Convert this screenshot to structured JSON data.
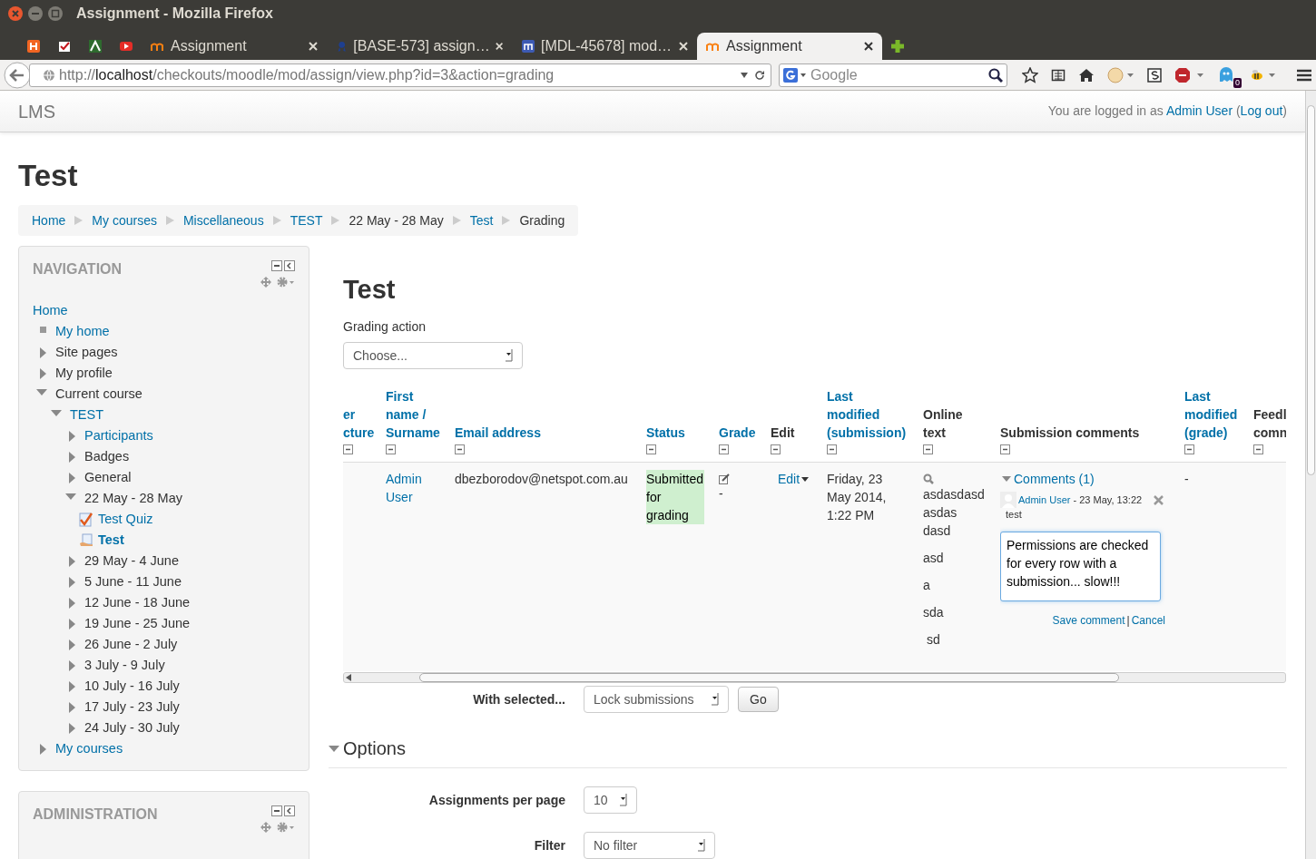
{
  "window": {
    "title": "Assignment - Mozilla Firefox"
  },
  "tabs": [
    {
      "kind": "pinned",
      "selected": false
    },
    {
      "kind": "pinned",
      "selected": false
    },
    {
      "kind": "pinned",
      "selected": false
    },
    {
      "kind": "pinned",
      "selected": false
    },
    {
      "kind": "full",
      "label": "Assignment",
      "selected": false
    },
    {
      "kind": "full",
      "label": "[BASE-573] assign…",
      "selected": false
    },
    {
      "kind": "full",
      "label": "[MDL-45678] mod…",
      "selected": false
    },
    {
      "kind": "full",
      "label": "Assignment",
      "selected": true
    }
  ],
  "address_bar": {
    "scheme": "http://",
    "host": "localhost",
    "path": "/checkouts/moodle/mod/assign/view.php?id=3&action=grading"
  },
  "search": {
    "placeholder": "Google"
  },
  "toolbar": {
    "badge": "0"
  },
  "site_header": {
    "brand": "LMS",
    "login_text": "You are logged in as",
    "user": "Admin User",
    "open_paren": "(",
    "logout": "Log out",
    "close_paren": ")"
  },
  "page_title": "Test",
  "breadcrumb": [
    {
      "label": "Home",
      "link": true
    },
    {
      "label": "My courses",
      "link": true
    },
    {
      "label": "Miscellaneous",
      "link": true
    },
    {
      "label": "TEST",
      "link": true
    },
    {
      "label": "22 May - 28 May",
      "link": false
    },
    {
      "label": "Test",
      "link": true
    },
    {
      "label": "Grading",
      "link": false
    }
  ],
  "navigation": {
    "title": "NAVIGATION",
    "items": [
      {
        "label": "Home",
        "kind": "plain",
        "link": true
      },
      {
        "label": "My home",
        "kind": "bullet",
        "link": true
      },
      {
        "label": "Site pages",
        "kind": "branch",
        "link": false,
        "expanded": false
      },
      {
        "label": "My profile",
        "kind": "branch",
        "link": false,
        "expanded": false
      },
      {
        "label": "Current course",
        "kind": "branch",
        "link": false,
        "expanded": true,
        "children": [
          {
            "label": "TEST",
            "kind": "branch",
            "link": true,
            "expanded": true,
            "children": [
              {
                "label": "Participants",
                "kind": "branch",
                "link": true,
                "expanded": false
              },
              {
                "label": "Badges",
                "kind": "branch",
                "link": false,
                "expanded": false
              },
              {
                "label": "General",
                "kind": "branch",
                "link": false,
                "expanded": false
              },
              {
                "label": "22 May - 28 May",
                "kind": "branch",
                "link": false,
                "expanded": true,
                "children": [
                  {
                    "label": "Test Quiz",
                    "kind": "quiz",
                    "link": true,
                    "current": false
                  },
                  {
                    "label": "Test",
                    "kind": "assign",
                    "link": true,
                    "current": true
                  }
                ]
              },
              {
                "label": "29 May - 4 June",
                "kind": "branch",
                "link": false,
                "expanded": false
              },
              {
                "label": "5 June - 11 June",
                "kind": "branch",
                "link": false,
                "expanded": false
              },
              {
                "label": "12 June - 18 June",
                "kind": "branch",
                "link": false,
                "expanded": false
              },
              {
                "label": "19 June - 25 June",
                "kind": "branch",
                "link": false,
                "expanded": false
              },
              {
                "label": "26 June - 2 July",
                "kind": "branch",
                "link": false,
                "expanded": false
              },
              {
                "label": "3 July - 9 July",
                "kind": "branch",
                "link": false,
                "expanded": false
              },
              {
                "label": "10 July - 16 July",
                "kind": "branch",
                "link": false,
                "expanded": false
              },
              {
                "label": "17 July - 23 July",
                "kind": "branch",
                "link": false,
                "expanded": false
              },
              {
                "label": "24 July - 30 July",
                "kind": "branch",
                "link": false,
                "expanded": false
              }
            ]
          }
        ]
      },
      {
        "label": "My courses",
        "kind": "branch",
        "link": true,
        "expanded": false
      }
    ]
  },
  "administration": {
    "title": "ADMINISTRATION"
  },
  "main": {
    "heading": "Test",
    "grading_action_label": "Grading action",
    "grading_action_value": "Choose..."
  },
  "table": {
    "columns": [
      {
        "lines": [
          "er",
          "cture"
        ],
        "link": true
      },
      {
        "lines": [
          "First",
          "name /",
          "Surname"
        ],
        "link": true
      },
      {
        "lines": [
          "Email address"
        ],
        "link": true
      },
      {
        "lines": [
          "Status"
        ],
        "link": true
      },
      {
        "lines": [
          "Grade"
        ],
        "link": true
      },
      {
        "lines": [
          "Edit"
        ],
        "link": false
      },
      {
        "lines": [
          "Last",
          "modified",
          "(submission)"
        ],
        "link": true
      },
      {
        "lines": [
          "Online",
          "text"
        ],
        "link": false
      },
      {
        "lines": [
          "Submission comments"
        ],
        "link": false
      },
      {
        "lines": [
          "Last",
          "modified",
          "(grade)"
        ],
        "link": true
      },
      {
        "lines": [
          "Feedl",
          "comn"
        ],
        "link": false
      }
    ],
    "rows": [
      {
        "name": [
          "Admin",
          "User"
        ],
        "email": "dbezborodov@netspot.com.au",
        "status": [
          "Submitted",
          "for",
          "grading"
        ],
        "grade": "-",
        "edit": "Edit",
        "last_modified": [
          "Friday, 23",
          "May 2014,",
          "1:22 PM"
        ],
        "online_text": [
          "asdasdasd",
          "asdas",
          "dasd",
          "asd",
          "a",
          "sda",
          " sd"
        ],
        "comments": {
          "toggle": "Comments (1)",
          "expanded": true,
          "entries": [
            {
              "author": "Admin User",
              "date": " - 23 May, 13:22",
              "text": "test"
            }
          ],
          "draft": "Permissions are checked for every row with a submission... slow!!!",
          "save": "Save comment",
          "separator": "|",
          "cancel": "Cancel"
        },
        "last_modified_grade": "-"
      }
    ]
  },
  "bulk": {
    "label": "With selected...",
    "value": "Lock submissions",
    "button": "Go"
  },
  "options": {
    "title": "Options",
    "expanded": true,
    "fields": [
      {
        "label": "Assignments per page",
        "value": "10"
      },
      {
        "label": "Filter",
        "value": "No filter"
      }
    ]
  }
}
